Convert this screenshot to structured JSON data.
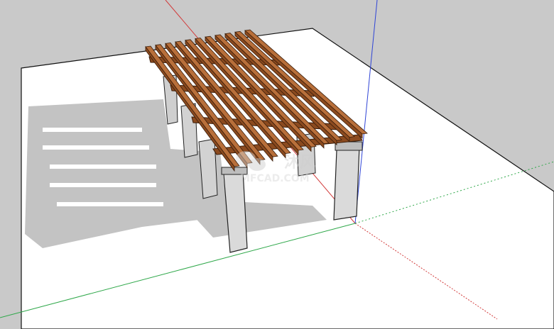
{
  "viewport": {
    "background": "#c9c9c9",
    "ground_color": "#ffffff",
    "axis_colors": {
      "red": "#d23b3b",
      "green": "#2fa84a",
      "blue": "#2f44d6"
    }
  },
  "model": {
    "wood_color": "#8b4a1f",
    "wood_light": "#b86f3a",
    "pillar_color": "#d9d9d9",
    "shadow_color": "#bdbdbd"
  },
  "watermark": {
    "main_text": "沐风",
    "sub_text": "MFCAD.COM",
    "icon_name": "wechat-bubble-icon"
  }
}
